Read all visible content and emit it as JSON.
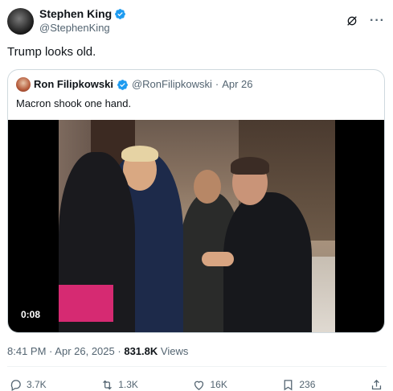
{
  "author": {
    "display_name": "Stephen King",
    "handle": "@StephenKing"
  },
  "tweet": {
    "text": "Trump looks old."
  },
  "quote": {
    "display_name": "Ron Filipkowski",
    "handle": "@RonFilipkowski",
    "separator": "·",
    "date": "Apr 26",
    "text": "Macron shook one hand.",
    "video_duration": "0:08"
  },
  "meta": {
    "time": "8:41 PM",
    "separator": "·",
    "date": "Apr 26, 2025",
    "separator2": "·",
    "views_count": "831.8K",
    "views_label": "Views"
  },
  "actions": {
    "replies": "3.7K",
    "reposts": "1.3K",
    "likes": "16K",
    "bookmarks": "236"
  },
  "colors": {
    "verified": "#1d9bf0",
    "muted": "#536471",
    "text": "#0f1419",
    "border": "#cfd9de"
  },
  "icons": [
    "verified-icon",
    "grok-icon",
    "more-icon",
    "reply-icon",
    "repost-icon",
    "like-icon",
    "bookmark-icon",
    "share-icon"
  ]
}
